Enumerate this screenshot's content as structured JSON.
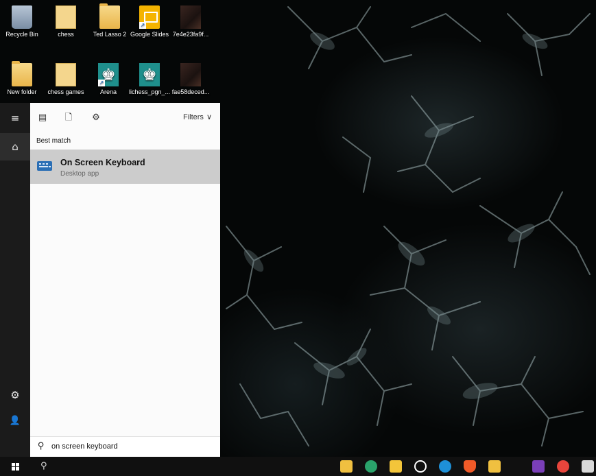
{
  "desktop": {
    "icons": [
      {
        "label": "Recycle Bin",
        "icon": "recycle-bin-icon"
      },
      {
        "label": "chess",
        "icon": "document-icon"
      },
      {
        "label": "Ted Lasso 2",
        "icon": "folder-icon"
      },
      {
        "label": "Google Slides",
        "icon": "google-slides-icon"
      },
      {
        "label": "7e4e23fa9f...",
        "icon": "image-file-icon"
      },
      {
        "label": "New folder",
        "icon": "folder-icon"
      },
      {
        "label": "chess games",
        "icon": "document-icon"
      },
      {
        "label": "Arena",
        "icon": "chess-app-icon"
      },
      {
        "label": "lichess_pgn_...",
        "icon": "chess-app-icon"
      },
      {
        "label": "fae58deced...",
        "icon": "image-file-icon"
      }
    ]
  },
  "start_rail": {
    "hamburger_icon": "≡",
    "home_icon": "⌂",
    "settings_icon": "⚙",
    "user_icon": "👤"
  },
  "search_panel": {
    "toolbar": {
      "apps_icon": "▤",
      "documents_icon": "🗋",
      "settings_icon": "⚙",
      "filters_label": "Filters",
      "filters_chevron": "∨"
    },
    "section_title": "Best match",
    "best_match": {
      "name": "On Screen Keyboard",
      "type": "Desktop app"
    },
    "query": "on screen keyboard",
    "search_icon": "⚲"
  },
  "taskbar": {
    "search_icon": "⚲",
    "apps": [
      {
        "name": "file-explorer-icon",
        "color": "#f0c040"
      },
      {
        "name": "chess-taskbar-icon",
        "color": "#2aa36b"
      },
      {
        "name": "mail-icon",
        "color": "#f3c53a"
      },
      {
        "name": "media-player-icon",
        "color": "#ffffff"
      },
      {
        "name": "edge-icon",
        "color": "#1e90d8"
      },
      {
        "name": "brave-icon",
        "color": "#f05a28"
      },
      {
        "name": "folder-taskbar-icon",
        "color": "#f0c040"
      },
      {
        "name": "onenote-icon",
        "color": "#7a3fb8"
      },
      {
        "name": "chrome-icon",
        "color": "#e8453c"
      },
      {
        "name": "word-icon",
        "color": "#d9d9d9"
      }
    ]
  },
  "colors": {
    "rail_bg": "#1b1b1b",
    "panel_bg": "#fbfbfb",
    "highlight": "#cccccc",
    "taskbar_bg": "#101010"
  }
}
